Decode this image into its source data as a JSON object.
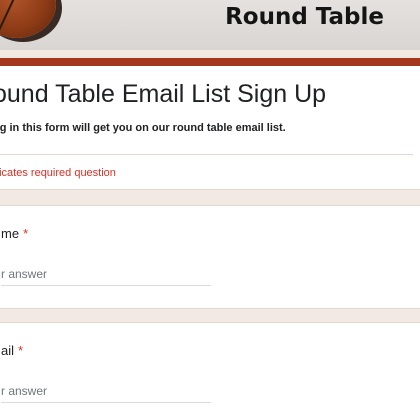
{
  "banner": {
    "title": "Round Table",
    "art_icon": "basketball-graphic-icon"
  },
  "form": {
    "title": "ound Table Email List Sign Up",
    "description": "ng in this form will get you on our round table email list.",
    "required_note": "dicates required question"
  },
  "questions": [
    {
      "label": "me",
      "required_mark": "*",
      "placeholder": "r answer"
    },
    {
      "label": "ail",
      "required_mark": "*",
      "placeholder": "r answer"
    }
  ],
  "colors": {
    "accent": "#a5371c",
    "required": "#d93025",
    "background": "#f3e9e3"
  }
}
